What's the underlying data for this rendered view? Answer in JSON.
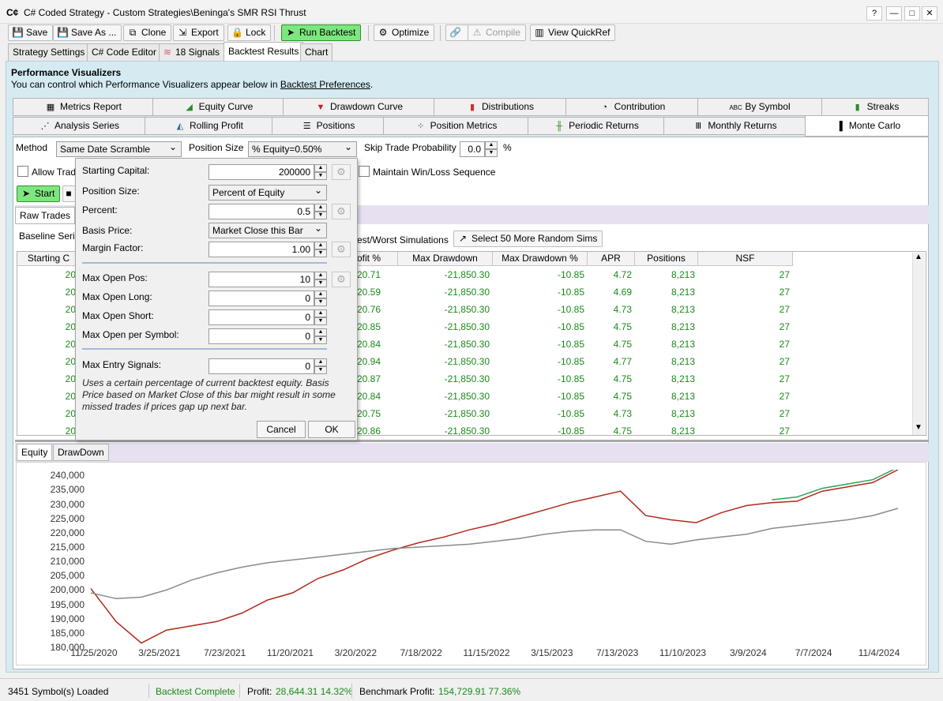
{
  "window": {
    "title": "C# Coded Strategy - Custom Strategies\\Beninga's SMR RSI Thrust",
    "buttons": {
      "help": "?",
      "minimize": "—",
      "maximize": "□",
      "close": "✕"
    }
  },
  "toolbar": {
    "save": "Save",
    "save_as": "Save As ...",
    "clone": "Clone",
    "export": "Export",
    "lock": "Lock",
    "run_backtest": "Run Backtest",
    "optimize": "Optimize",
    "compile": "Compile",
    "view_quickref": "View QuickRef"
  },
  "main_tabs": [
    "Strategy Settings",
    "C# Code Editor",
    "18 Signals",
    "Backtest Results",
    "Chart"
  ],
  "performance": {
    "title": "Performance Visualizers",
    "subtitle_prefix": "You can control which Performance Visualizers appear below in ",
    "subtitle_link": "Backtest Preferences",
    "subtitle_suffix": "."
  },
  "visualizer_tabs_row1": [
    "Metrics Report",
    "Equity Curve",
    "Drawdown Curve",
    "Distributions",
    "Contribution",
    "By Symbol",
    "Streaks"
  ],
  "visualizer_tabs_row2": [
    "Analysis Series",
    "Rolling Profit",
    "Positions",
    "Position Metrics",
    "Periodic Returns",
    "Monthly Returns",
    "Monte Carlo"
  ],
  "monte_carlo": {
    "method_label": "Method",
    "method_value": "Same Date Scramble",
    "position_size_label": "Position Size",
    "position_size_value": "% Equity=0.50%",
    "skip_label": "Skip Trade Probability",
    "skip_value": "0.0",
    "skip_unit": "%",
    "allow_label": "Allow Trad",
    "maintain_label": "Maintain Win/Loss Sequence",
    "start": "Start",
    "raw_trades_tab": "Raw Trades",
    "baseline_label": "Baseline Seria",
    "best_worst_label": "est/Worst Simulations",
    "select_more": "Select 50 More Random Sims"
  },
  "table": {
    "headers": [
      "Starting C",
      "ofit %",
      "Max Drawdown",
      "Max Drawdown %",
      "APR",
      "Positions",
      "NSF"
    ],
    "rows": [
      [
        "20",
        "20.71",
        "-21,850.30",
        "-10.85",
        "4.72",
        "8,213",
        "27"
      ],
      [
        "20",
        "20.59",
        "-21,850.30",
        "-10.85",
        "4.69",
        "8,213",
        "27"
      ],
      [
        "20",
        "20.76",
        "-21,850.30",
        "-10.85",
        "4.73",
        "8,213",
        "27"
      ],
      [
        "20",
        "20.85",
        "-21,850.30",
        "-10.85",
        "4.75",
        "8,213",
        "27"
      ],
      [
        "20",
        "20.84",
        "-21,850.30",
        "-10.85",
        "4.75",
        "8,213",
        "27"
      ],
      [
        "20",
        "20.94",
        "-21,850.30",
        "-10.85",
        "4.77",
        "8,213",
        "27"
      ],
      [
        "20",
        "20.87",
        "-21,850.30",
        "-10.85",
        "4.75",
        "8,213",
        "27"
      ],
      [
        "20",
        "20.84",
        "-21,850.30",
        "-10.85",
        "4.75",
        "8,213",
        "27"
      ],
      [
        "20",
        "20.75",
        "-21,850.30",
        "-10.85",
        "4.73",
        "8,213",
        "27"
      ],
      [
        "20",
        "20.86",
        "-21,850.30",
        "-10.85",
        "4.75",
        "8,213",
        "27"
      ]
    ]
  },
  "chart_tabs": [
    "Equity",
    "DrawDown"
  ],
  "chart_data": {
    "type": "line",
    "title": "",
    "xlabel": "",
    "ylabel": "",
    "x_ticks": [
      "11/25/2020",
      "3/25/2021",
      "7/23/2021",
      "11/20/2021",
      "3/20/2022",
      "7/18/2022",
      "11/15/2022",
      "3/15/2023",
      "7/13/2023",
      "11/10/2023",
      "3/9/2024",
      "7/7/2024",
      "11/4/2024"
    ],
    "y_ticks": [
      "240,000",
      "235,000",
      "230,000",
      "225,000",
      "220,000",
      "215,000",
      "210,000",
      "205,000",
      "200,000",
      "195,000",
      "190,000",
      "185,000",
      "180,000"
    ],
    "ylim": [
      180000,
      242000
    ],
    "series": [
      {
        "values": [
          200500,
          189000,
          181500,
          186000,
          187500,
          189000,
          192000,
          196500,
          199000,
          204000,
          207000,
          211000,
          214000,
          216500,
          218500,
          221000,
          223000,
          225500,
          228000,
          230500,
          232500,
          234500,
          226000,
          224500,
          223500,
          227000,
          229500,
          230500,
          231000,
          234500,
          236000,
          237500,
          242000
        ],
        "color": "#b02a1a"
      },
      {
        "values": [
          199000,
          197000,
          197500,
          200000,
          203500,
          206000,
          208000,
          209500,
          210500,
          211500,
          212500,
          213500,
          214500,
          215000,
          215500,
          216000,
          217000,
          218000,
          219500,
          220500,
          221000,
          221000,
          217000,
          216000,
          217500,
          218500,
          219500,
          221500,
          222500,
          223500,
          224500,
          226000,
          228500
        ],
        "color": "#8a8a8a"
      },
      {
        "values": [
          null,
          null,
          null,
          null,
          null,
          null,
          null,
          null,
          null,
          null,
          null,
          null,
          null,
          null,
          null,
          null,
          null,
          null,
          null,
          null,
          null,
          null,
          null,
          null,
          null,
          null,
          null,
          231500,
          232500,
          235500,
          237000,
          238500,
          242800
        ],
        "color": "#2aa35a"
      }
    ]
  },
  "popup": {
    "starting_capital_label": "Starting Capital:",
    "starting_capital_value": "200000",
    "position_size_label": "Position Size:",
    "position_size_value": "Percent of Equity",
    "percent_label": "Percent:",
    "percent_value": "0.5",
    "basis_price_label": "Basis Price:",
    "basis_price_value": "Market Close this Bar",
    "margin_factor_label": "Margin Factor:",
    "margin_factor_value": "1.00",
    "max_open_pos_label": "Max Open Pos:",
    "max_open_pos_value": "10",
    "max_open_long_label": "Max Open Long:",
    "max_open_long_value": "0",
    "max_open_short_label": "Max Open Short:",
    "max_open_short_value": "0",
    "max_open_per_symbol_label": "Max Open per Symbol:",
    "max_open_per_symbol_value": "0",
    "max_entry_signals_label": "Max Entry Signals:",
    "max_entry_signals_value": "0",
    "note": "Uses a certain percentage of current backtest equity. Basis Price based on Market Close of this bar might result in some missed trades if prices gap up next bar.",
    "cancel": "Cancel",
    "ok": "OK"
  },
  "status": {
    "symbols": "3451 Symbol(s) Loaded",
    "backtest": "Backtest Complete",
    "profit_label": "Profit:",
    "profit_value": "28,644.31 14.32%",
    "benchmark_label": "Benchmark Profit:",
    "benchmark_value": "154,729.91 77.36%"
  },
  "colors": {
    "run_green": "#7ee67e",
    "value_green": "#1a8a1a",
    "equity_red": "#b02a1a",
    "benchmark_gray": "#8a8a8a",
    "panel_blue": "#d5ebf1"
  }
}
